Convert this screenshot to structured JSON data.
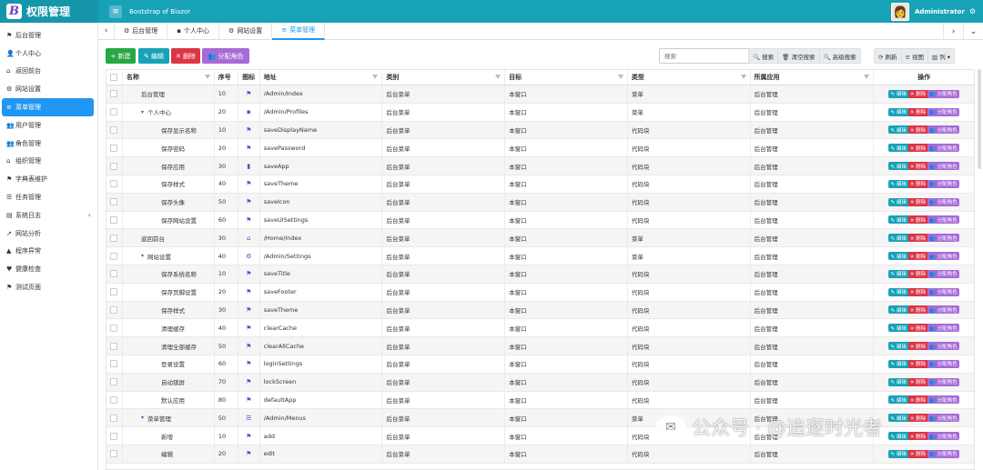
{
  "header": {
    "brand_letter": "B",
    "brand_title": "权限管理",
    "menu_icon": "≡",
    "app_subtitle": "Bootstrap of Blazor",
    "user_name": "Administrator",
    "avatar_glyph": "👩",
    "gear_glyph": "⚙"
  },
  "sidebar": {
    "items": [
      {
        "label": "后台管理",
        "icon": "⚑",
        "icon_name": "flag-icon"
      },
      {
        "label": "个人中心",
        "icon": "👤",
        "icon_name": "user-icon"
      },
      {
        "label": "返回前台",
        "icon": "⌂",
        "icon_name": "home-icon"
      },
      {
        "label": "网站设置",
        "icon": "⚙",
        "icon_name": "gear-icon"
      },
      {
        "label": "菜单管理",
        "icon": "≡",
        "icon_name": "menu-icon",
        "active": true
      },
      {
        "label": "用户管理",
        "icon": "👥",
        "icon_name": "users-icon"
      },
      {
        "label": "角色管理",
        "icon": "👥",
        "icon_name": "roles-icon"
      },
      {
        "label": "组织管理",
        "icon": "⌂",
        "icon_name": "org-icon"
      },
      {
        "label": "字典表维护",
        "icon": "⚑",
        "icon_name": "book-icon"
      },
      {
        "label": "任务管理",
        "icon": "☰",
        "icon_name": "tasks-icon"
      },
      {
        "label": "系统日志",
        "icon": "▤",
        "icon_name": "log-icon",
        "chevron": "‹"
      },
      {
        "label": "网站分析",
        "icon": "↗",
        "icon_name": "chart-icon"
      },
      {
        "label": "程序异常",
        "icon": "▲",
        "icon_name": "warning-icon"
      },
      {
        "label": "健康检查",
        "icon": "♥",
        "icon_name": "heart-icon"
      },
      {
        "label": "测试页面",
        "icon": "⚑",
        "icon_name": "flag-test-icon"
      }
    ]
  },
  "tabs": {
    "prev": "‹",
    "next": "›",
    "more": "⌄",
    "items": [
      {
        "label": "后台管理",
        "icon": "⚙"
      },
      {
        "label": "个人中心",
        "icon": "▪"
      },
      {
        "label": "网站设置",
        "icon": "⚙"
      },
      {
        "label": "菜单管理",
        "icon": "≡",
        "active": true
      }
    ]
  },
  "toolbar": {
    "new_label": "+ 新建",
    "edit_label": "✎ 编辑",
    "delete_label": "✕ 删除",
    "role_label": "👥 分配角色",
    "search_placeholder": "搜索",
    "search_label": "🔍 搜索",
    "clear_label": "🗑 清空搜索",
    "advanced_label": "🔍 高级搜索",
    "refresh_label": "⟳ 刷新",
    "view_label": "≡ 视图",
    "columns_label": "▥ 列 ▾"
  },
  "table": {
    "columns": {
      "name": "名称",
      "seq": "序号",
      "icon": "图标",
      "addr": "地址",
      "cat": "类别",
      "tgt": "目标",
      "type": "类型",
      "app": "所属应用",
      "ops": "操作"
    },
    "op_labels": {
      "edit": "✎ 编辑",
      "del": "✕ 删除",
      "role": "👥 分配角色"
    },
    "rows": [
      {
        "name": "后台管理",
        "level": 1,
        "seq": "10",
        "icon": "⚑",
        "addr": "/Admin/Index",
        "cat": "后台菜单",
        "tgt": "本窗口",
        "type": "菜单",
        "app": "后台管理"
      },
      {
        "name": "个人中心",
        "level": 0,
        "caret": "▾",
        "seq": "20",
        "icon": "▪",
        "addr": "/Admin/Profiles",
        "cat": "后台菜单",
        "tgt": "本窗口",
        "type": "菜单",
        "app": "后台管理"
      },
      {
        "name": "保存显示名称",
        "level": 2,
        "seq": "10",
        "icon": "⚑",
        "addr": "saveDisplayName",
        "cat": "后台菜单",
        "tgt": "本窗口",
        "type": "代码块",
        "app": "后台管理"
      },
      {
        "name": "保存密码",
        "level": 2,
        "seq": "20",
        "icon": "⚑",
        "addr": "savePassword",
        "cat": "后台菜单",
        "tgt": "本窗口",
        "type": "代码块",
        "app": "后台管理"
      },
      {
        "name": "保存应用",
        "level": 2,
        "seq": "30",
        "icon": "▮",
        "addr": "saveApp",
        "cat": "后台菜单",
        "tgt": "本窗口",
        "type": "代码块",
        "app": "后台管理"
      },
      {
        "name": "保存样式",
        "level": 2,
        "seq": "40",
        "icon": "⚑",
        "addr": "saveTheme",
        "cat": "后台菜单",
        "tgt": "本窗口",
        "type": "代码块",
        "app": "后台管理"
      },
      {
        "name": "保存头像",
        "level": 2,
        "seq": "50",
        "icon": "⚑",
        "addr": "saveIcon",
        "cat": "后台菜单",
        "tgt": "本窗口",
        "type": "代码块",
        "app": "后台管理"
      },
      {
        "name": "保存网站设置",
        "level": 2,
        "seq": "60",
        "icon": "⚑",
        "addr": "saveUISettings",
        "cat": "后台菜单",
        "tgt": "本窗口",
        "type": "代码块",
        "app": "后台管理"
      },
      {
        "name": "返回前台",
        "level": 1,
        "seq": "30",
        "icon": "⌂",
        "addr": "/Home/Index",
        "cat": "后台菜单",
        "tgt": "本窗口",
        "type": "菜单",
        "app": "后台管理"
      },
      {
        "name": "网站设置",
        "level": 0,
        "caret": "▾",
        "seq": "40",
        "icon": "⚙",
        "addr": "/Admin/Settings",
        "cat": "后台菜单",
        "tgt": "本窗口",
        "type": "菜单",
        "app": "后台管理"
      },
      {
        "name": "保存系统名称",
        "level": 2,
        "seq": "10",
        "icon": "⚑",
        "addr": "saveTitle",
        "cat": "后台菜单",
        "tgt": "本窗口",
        "type": "代码块",
        "app": "后台管理"
      },
      {
        "name": "保存页脚设置",
        "level": 2,
        "seq": "20",
        "icon": "⚑",
        "addr": "saveFooter",
        "cat": "后台菜单",
        "tgt": "本窗口",
        "type": "代码块",
        "app": "后台管理"
      },
      {
        "name": "保存样式",
        "level": 2,
        "seq": "30",
        "icon": "⚑",
        "addr": "saveTheme",
        "cat": "后台菜单",
        "tgt": "本窗口",
        "type": "代码块",
        "app": "后台管理"
      },
      {
        "name": "清理缓存",
        "level": 2,
        "seq": "40",
        "icon": "⚑",
        "addr": "clearCache",
        "cat": "后台菜单",
        "tgt": "本窗口",
        "type": "代码块",
        "app": "后台管理"
      },
      {
        "name": "清理全部缓存",
        "level": 2,
        "seq": "50",
        "icon": "⚑",
        "addr": "clearAllCache",
        "cat": "后台菜单",
        "tgt": "本窗口",
        "type": "代码块",
        "app": "后台管理"
      },
      {
        "name": "登录设置",
        "level": 2,
        "seq": "60",
        "icon": "⚑",
        "addr": "loginSettings",
        "cat": "后台菜单",
        "tgt": "本窗口",
        "type": "代码块",
        "app": "后台管理"
      },
      {
        "name": "自动锁屏",
        "level": 2,
        "seq": "70",
        "icon": "⚑",
        "addr": "lockScreen",
        "cat": "后台菜单",
        "tgt": "本窗口",
        "type": "代码块",
        "app": "后台管理"
      },
      {
        "name": "默认应用",
        "level": 2,
        "seq": "80",
        "icon": "⚑",
        "addr": "defaultApp",
        "cat": "后台菜单",
        "tgt": "本窗口",
        "type": "代码块",
        "app": "后台管理"
      },
      {
        "name": "菜单管理",
        "level": 0,
        "caret": "▾",
        "seq": "50",
        "icon": "☰",
        "addr": "/Admin/Menus",
        "cat": "后台菜单",
        "tgt": "本窗口",
        "type": "菜单",
        "app": "后台管理"
      },
      {
        "name": "新增",
        "level": 2,
        "seq": "10",
        "icon": "⚑",
        "addr": "add",
        "cat": "后台菜单",
        "tgt": "本窗口",
        "type": "代码块",
        "app": "后台管理"
      },
      {
        "name": "编辑",
        "level": 2,
        "seq": "20",
        "icon": "⚑",
        "addr": "edit",
        "cat": "后台菜单",
        "tgt": "本窗口",
        "type": "代码块",
        "app": "后台管理"
      }
    ]
  },
  "watermark": {
    "text": "公众号 · @追逐时光者",
    "logo": "✉"
  },
  "colors": {
    "header_bg": "#17a2b8",
    "active_blue": "#2196f3",
    "new_green": "#28a745",
    "edit_teal": "#17a2b8",
    "delete_red": "#dc3545",
    "role_purple": "#a66bd6",
    "icon_purple": "#6f42c1"
  }
}
